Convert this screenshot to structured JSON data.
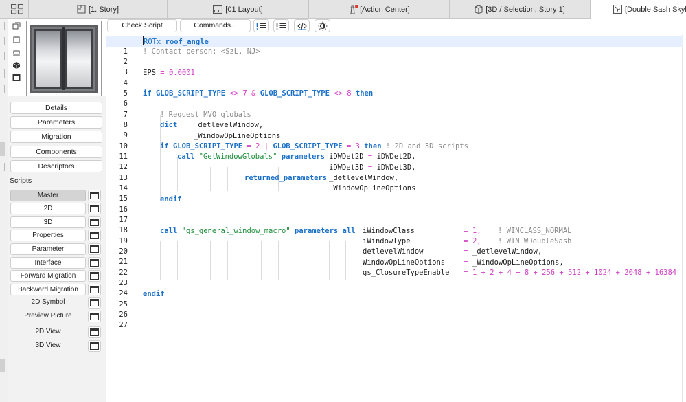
{
  "tabs": [
    {
      "label": "[1. Story]",
      "icon": "floorplan-icon"
    },
    {
      "label": "[01 Layout]",
      "icon": "layout-icon"
    },
    {
      "label": "[Action Center]",
      "icon": "lighthouse-icon"
    },
    {
      "label": "[3D / Selection, Story 1]",
      "icon": "3d-view-icon"
    },
    {
      "label": "[Double Sash Skyligh",
      "icon": "object-editor-icon"
    }
  ],
  "side": {
    "buttons": [
      "Details",
      "Parameters",
      "Migration",
      "Components",
      "Descriptors"
    ],
    "scripts_label": "Scripts",
    "scripts": [
      "Master",
      "2D",
      "3D",
      "Properties",
      "Parameter",
      "Interface",
      "Forward Migration",
      "Backward Migration",
      "2D Symbol",
      "Preview Picture",
      "2D View",
      "3D View"
    ]
  },
  "toolbar": {
    "check_script": "Check Script",
    "commands": "Commands..."
  },
  "code": {
    "line_numbers": [
      "1",
      "2",
      "3",
      "4",
      "5",
      "6",
      "7",
      "8",
      "9",
      "10",
      "11",
      "12",
      "13",
      "14",
      "15",
      "16",
      "17",
      "18",
      "19",
      "20",
      "21",
      "22",
      "23",
      "24",
      "25",
      "26",
      "27"
    ],
    "l1_kw": "ROTx",
    "l1_name": "roof_angle",
    "l2": "! Contact person: <SzL, NJ>",
    "l4_var": "EPS",
    "l4_eq": "=",
    "l4_num": "0.0001",
    "l6_if": "if",
    "l6_a": "GLOB_SCRIPT_TYPE",
    "l6_op1": "<>",
    "l6_n1": "7",
    "l6_amp": "&",
    "l6_b": "GLOB_SCRIPT_TYPE",
    "l6_op2": "<>",
    "l6_n2": "8",
    "l6_then": "then",
    "l8": "! Request MVO globals",
    "l9_dict": "dict",
    "l9_var": "_detlevelWindow,",
    "l10_var": "_WindowOpLineOptions",
    "l11_if": "if",
    "l11_a": "GLOB_SCRIPT_TYPE",
    "l11_eq1": "=",
    "l11_n1": "2",
    "l11_bar": "|",
    "l11_b": "GLOB_SCRIPT_TYPE",
    "l11_eq2": "=",
    "l11_n2": "3",
    "l11_then": "then",
    "l11_cm": "! 2D and 3D scripts",
    "l12_call": "call",
    "l12_str": "\"GetWindowGlobals\"",
    "l12_params": "parameters",
    "l12_a": "iDWDet2D",
    "l12_eq": "=",
    "l12_b": "iDWDet2D,",
    "l13_a": "iDWDet3D",
    "l13_eq": "=",
    "l13_b": "iDWDet3D,",
    "l14_ret": "returned_parameters",
    "l14_var": "_detlevelWindow,",
    "l15_var": "_WindowOpLineOptions",
    "l16_endif": "endif",
    "l19_call": "call",
    "l19_str": "\"gs_general_window_macro\"",
    "l19_params": "parameters",
    "l19_all": "all",
    "l19_name": "iWindowClass",
    "l19_eq": "=",
    "l19_val": "1,",
    "l19_cm": "! WINCLASS_NORMAL",
    "l20_name": "iWindowType",
    "l20_eq": "=",
    "l20_val": "2,",
    "l20_cm": "! WIN_WDoubleSash",
    "l21_name": "detlevelWindow",
    "l21_eq": "=",
    "l21_val": "_detlevelWindow,",
    "l22_name": "WindowOpLineOptions",
    "l22_eq": "=",
    "l22_val": "_WindowOpLineOptions,",
    "l23_name": "gs_ClosureTypeEnable",
    "l23_eq": "=",
    "l23_val": "1 + 2 + 4 + 8 + 256 + 512 + 1024 + 2048 + 16384",
    "l25_endif": "endif"
  }
}
